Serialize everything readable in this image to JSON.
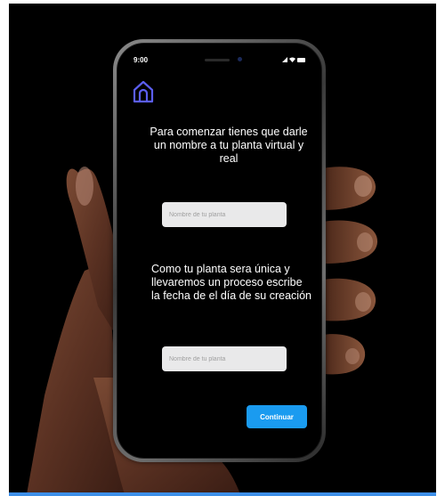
{
  "status_bar": {
    "time": "9:00"
  },
  "nav": {
    "home_icon": "home-icon",
    "accent_color": "#5b5ef0"
  },
  "form": {
    "prompt_name": "Para comenzar tienes que darle un nombre a tu planta virtual y real",
    "name_input": {
      "value": "",
      "placeholder": "Nombre de tu planta"
    },
    "prompt_date": "Como tu planta sera única y llevaremos un proceso escribe la fecha de el día de su creación",
    "date_input": {
      "value": "",
      "placeholder": "Nombre de tu planta"
    },
    "continue_label": "Continuar",
    "button_color": "#1a9bf0"
  }
}
